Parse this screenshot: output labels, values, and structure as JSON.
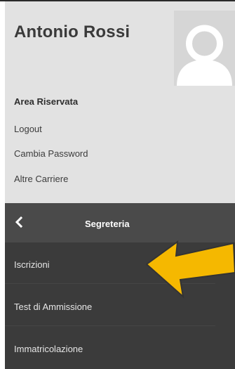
{
  "user": {
    "name": "Antonio Rossi",
    "avatar_icon": "user-avatar-icon"
  },
  "user_menu": {
    "section_title": "Area Riservata",
    "links": [
      {
        "label": "Logout"
      },
      {
        "label": "Cambia Password"
      },
      {
        "label": "Altre Carriere"
      }
    ]
  },
  "nav": {
    "back_icon": "chevron-left-icon",
    "title": "Segreteria",
    "items": [
      {
        "label": "Iscrizioni"
      },
      {
        "label": "Test di Ammissione"
      },
      {
        "label": "Immatricolazione"
      }
    ]
  },
  "annotation": {
    "arrow_icon": "pointing-arrow-icon"
  },
  "colors": {
    "user_panel_bg": "#e2e2e2",
    "menu_bg": "#3b3b3b",
    "menu_header_bg": "#4a4a4a",
    "arrow_fill": "#f5b800",
    "arrow_stroke": "#333333"
  }
}
